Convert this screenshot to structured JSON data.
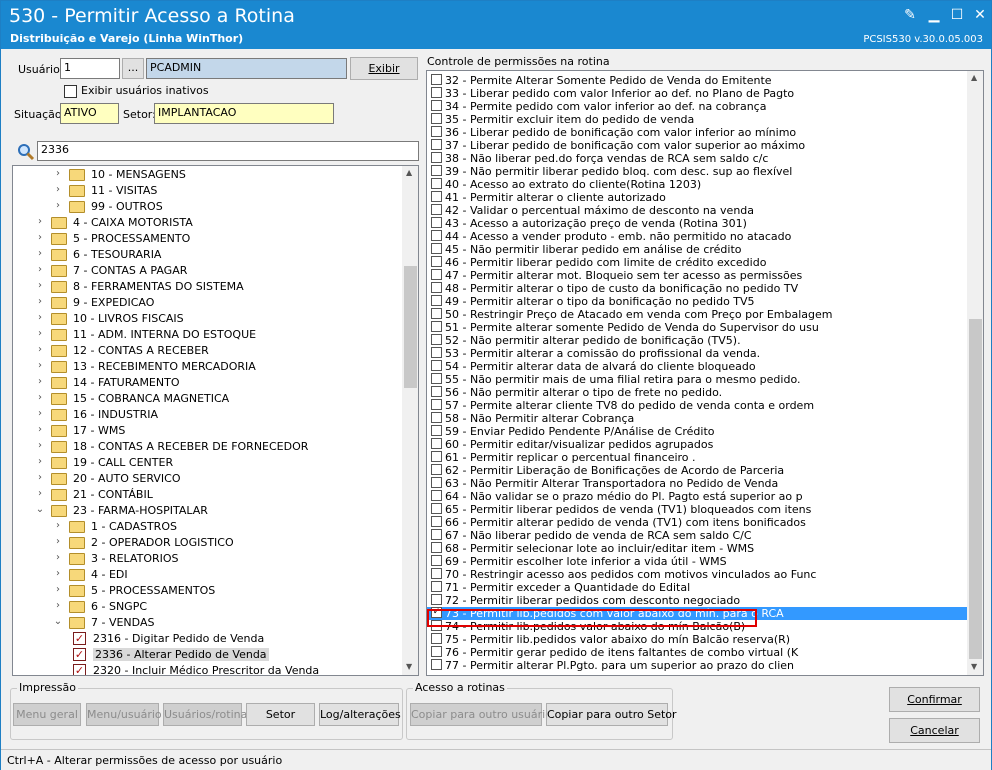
{
  "window": {
    "title": "530 - Permitir Acesso a Rotina",
    "subtitle": "Distribuição e Varejo (Linha WinThor)",
    "version": "PCSIS530  v.30.0.05.003"
  },
  "left": {
    "usuario_label": "Usuário:",
    "usuario_value": "1",
    "ellipsis_btn": "...",
    "usuario_name": "PCADMIN",
    "exibir_btn": "Exibir",
    "exibir_inativos": "Exibir usuários inativos",
    "situacao_label": "Situação:",
    "situacao_value": "ATIVO",
    "setor_label": "Setor:",
    "setor_value": "IMPLANTACAO",
    "search_value": "2336"
  },
  "tree": [
    {
      "label": "10 - MENSAGENS",
      "level": 2,
      "kind": "folder"
    },
    {
      "label": "11 - VISITAS",
      "level": 2,
      "kind": "folder"
    },
    {
      "label": "99 - OUTROS",
      "level": 2,
      "kind": "folder"
    },
    {
      "label": "4 - CAIXA MOTORISTA",
      "level": 1,
      "kind": "folder"
    },
    {
      "label": "5 - PROCESSAMENTO",
      "level": 1,
      "kind": "folder"
    },
    {
      "label": "6 - TESOURARIA",
      "level": 1,
      "kind": "folder"
    },
    {
      "label": "7 - CONTAS A PAGAR",
      "level": 1,
      "kind": "folder"
    },
    {
      "label": "8 - FERRAMENTAS DO SISTEMA",
      "level": 1,
      "kind": "folder"
    },
    {
      "label": "9 - EXPEDICAO",
      "level": 1,
      "kind": "folder"
    },
    {
      "label": "10 - LIVROS FISCAIS",
      "level": 1,
      "kind": "folder"
    },
    {
      "label": "11 - ADM. INTERNA DO ESTOQUE",
      "level": 1,
      "kind": "folder"
    },
    {
      "label": "12 - CONTAS A RECEBER",
      "level": 1,
      "kind": "folder"
    },
    {
      "label": "13 - RECEBIMENTO MERCADORIA",
      "level": 1,
      "kind": "folder"
    },
    {
      "label": "14 - FATURAMENTO",
      "level": 1,
      "kind": "folder"
    },
    {
      "label": "15 - COBRANCA MAGNETICA",
      "level": 1,
      "kind": "folder"
    },
    {
      "label": "16 - INDUSTRIA",
      "level": 1,
      "kind": "folder"
    },
    {
      "label": "17 - WMS",
      "level": 1,
      "kind": "folder"
    },
    {
      "label": "18 - CONTAS A RECEBER DE FORNECEDOR",
      "level": 1,
      "kind": "folder"
    },
    {
      "label": "19 - CALL CENTER",
      "level": 1,
      "kind": "folder"
    },
    {
      "label": "20 - AUTO SERVICO",
      "level": 1,
      "kind": "folder"
    },
    {
      "label": "21 - CONTÁBIL",
      "level": 1,
      "kind": "folder"
    },
    {
      "label": "23 - FARMA-HOSPITALAR",
      "level": 1,
      "kind": "folder",
      "expanded": true
    },
    {
      "label": "1 - CADASTROS",
      "level": 2,
      "kind": "folder"
    },
    {
      "label": "2 - OPERADOR LOGISTICO",
      "level": 2,
      "kind": "folder"
    },
    {
      "label": "3 - RELATORIOS",
      "level": 2,
      "kind": "folder"
    },
    {
      "label": "4 - EDI",
      "level": 2,
      "kind": "folder"
    },
    {
      "label": "5 - PROCESSAMENTOS",
      "level": 2,
      "kind": "folder"
    },
    {
      "label": "6 - SNGPC",
      "level": 2,
      "kind": "folder"
    },
    {
      "label": "7 - VENDAS",
      "level": 2,
      "kind": "folder",
      "expanded": true
    },
    {
      "label": "2316 - Digitar Pedido de Venda",
      "level": 3,
      "kind": "check"
    },
    {
      "label": "2336 - Alterar Pedido de Venda",
      "level": 3,
      "kind": "check",
      "selected": true
    },
    {
      "label": "2320 - Incluir Médico Prescritor da Venda",
      "level": 3,
      "kind": "check"
    }
  ],
  "perm_title": "Controle de permissões na rotina",
  "permissions": [
    {
      "text": "32 - Permite Alterar Somente Pedido de Venda do Emitente",
      "checked": false
    },
    {
      "text": "33 - Liberar pedido com valor Inferior ao def. no Plano de Pagto",
      "checked": false
    },
    {
      "text": "34 - Permite pedido com valor inferior ao def. na cobrança",
      "checked": false
    },
    {
      "text": "35 - Permitir excluir item do pedido de venda",
      "checked": false
    },
    {
      "text": "36 - Liberar pedido de bonificação com valor inferior ao mínimo",
      "checked": false
    },
    {
      "text": "37 - Liberar pedido de bonificação com valor superior ao máximo",
      "checked": false
    },
    {
      "text": "38 - Não liberar ped.do força vendas de RCA sem saldo c/c",
      "checked": false
    },
    {
      "text": "39 - Não permitir liberar pedido bloq. com desc. sup ao flexível",
      "checked": false
    },
    {
      "text": "40 - Acesso ao extrato do cliente(Rotina 1203)",
      "checked": false
    },
    {
      "text": "41 - Permitir alterar o cliente autorizado",
      "checked": false
    },
    {
      "text": "42 - Validar o percentual máximo de desconto na venda",
      "checked": false
    },
    {
      "text": "43 - Acesso a autorização preço de venda (Rotina 301)",
      "checked": false
    },
    {
      "text": "44 - Acesso a vender produto - emb. não permitido no atacado",
      "checked": false
    },
    {
      "text": "45 - Não permitir liberar pedido em análise de crédito",
      "checked": false
    },
    {
      "text": "46 - Permitir liberar pedido com limite de crédito excedido",
      "checked": false
    },
    {
      "text": "47 - Permitir alterar mot. Bloqueio sem ter acesso as permissões",
      "checked": false
    },
    {
      "text": "48 - Permitir alterar o tipo de custo da bonificação no pedido TV",
      "checked": false
    },
    {
      "text": "49 - Permitir alterar o tipo da bonificação no pedido TV5",
      "checked": false
    },
    {
      "text": "50 - Restringir Preço de Atacado em venda com Preço por Embalagem",
      "checked": false
    },
    {
      "text": "51 - Permite alterar somente Pedido de Venda do Supervisor do usu",
      "checked": false
    },
    {
      "text": "52 - Não permitir alterar pedido de bonificação (TV5).",
      "checked": false
    },
    {
      "text": "53 - Permitir alterar a comissão do profissional da venda.",
      "checked": false
    },
    {
      "text": "54 - Permitir alterar data de alvará do cliente bloqueado",
      "checked": false
    },
    {
      "text": "55 - Não permitir mais de uma filial retira para o mesmo pedido.",
      "checked": false
    },
    {
      "text": "56 - Não permitir alterar o tipo de frete no pedido.",
      "checked": false
    },
    {
      "text": "57 - Permite alterar cliente TV8 do pedido de venda conta e ordem",
      "checked": false
    },
    {
      "text": "58 - Não Permitir alterar Cobrança",
      "checked": false
    },
    {
      "text": "59 - Enviar Pedido Pendente P/Análise de Crédito",
      "checked": false
    },
    {
      "text": "60 - Permitir editar/visualizar pedidos agrupados",
      "checked": false
    },
    {
      "text": "61 - Permitir replicar o percentual financeiro .",
      "checked": false
    },
    {
      "text": "62 - Permitir Liberação de Bonificações de Acordo de Parceria",
      "checked": false
    },
    {
      "text": "63 - Não Permitir Alterar Transportadora no Pedido de Venda",
      "checked": false
    },
    {
      "text": "64 - Não validar se o prazo médio do Pl. Pagto está superior ao p",
      "checked": false
    },
    {
      "text": "65 - Permitir liberar pedidos de venda (TV1) bloqueados com itens",
      "checked": false
    },
    {
      "text": "66 - Permitir alterar pedido de venda (TV1) com itens bonificados",
      "checked": false
    },
    {
      "text": "67 - Não liberar pedido de venda de RCA sem saldo C/C",
      "checked": false
    },
    {
      "text": "68 - Permitir selecionar lote ao incluir/editar item - WMS",
      "checked": false
    },
    {
      "text": "69 - Permitir escolher lote inferior a vida útil - WMS",
      "checked": false
    },
    {
      "text": "70 - Restringir acesso aos pedidos com motivos vinculados ao Func",
      "checked": false
    },
    {
      "text": "71 - Permitir exceder a Quantidade do Edital",
      "checked": false
    },
    {
      "text": "72 - Permitir liberar pedidos com desconto negociado",
      "checked": false
    },
    {
      "text": "73 - Permitir lib.pedidos com valor abaixo do mín. para o RCA",
      "checked": true,
      "selected": true
    },
    {
      "text": "74 - Permitir lib.pedidos valor abaixo do mín Balcão(B)",
      "checked": false
    },
    {
      "text": "75 - Permitir lib.pedidos valor abaixo do mín Balcão reserva(R)",
      "checked": false
    },
    {
      "text": "76 - Permitir gerar pedido de itens faltantes de combo virtual (K",
      "checked": false
    },
    {
      "text": "77 - Permitir alterar Pl.Pgto. para um superior ao prazo do clien",
      "checked": false
    }
  ],
  "impressao": {
    "title": "Impressão",
    "menu_geral": "Menu geral",
    "menu_usuario": "Menu/usuário",
    "usuarios_rotina": "Usuários/rotina",
    "setor": "Setor",
    "log": "Log/alterações"
  },
  "acesso": {
    "title": "Acesso a rotinas",
    "copiar_usuario": "Copiar para outro usuário",
    "copiar_setor": "Copiar para outro Setor"
  },
  "confirmar": "Confirmar",
  "cancelar": "Cancelar",
  "status": "Ctrl+A - Alterar permissões de acesso por usuário",
  "colors": {
    "titlebar": "#1a88d0",
    "selection": "#3399ff",
    "highlight_box": "#e00000",
    "yellow_field": "#ffffc0"
  }
}
